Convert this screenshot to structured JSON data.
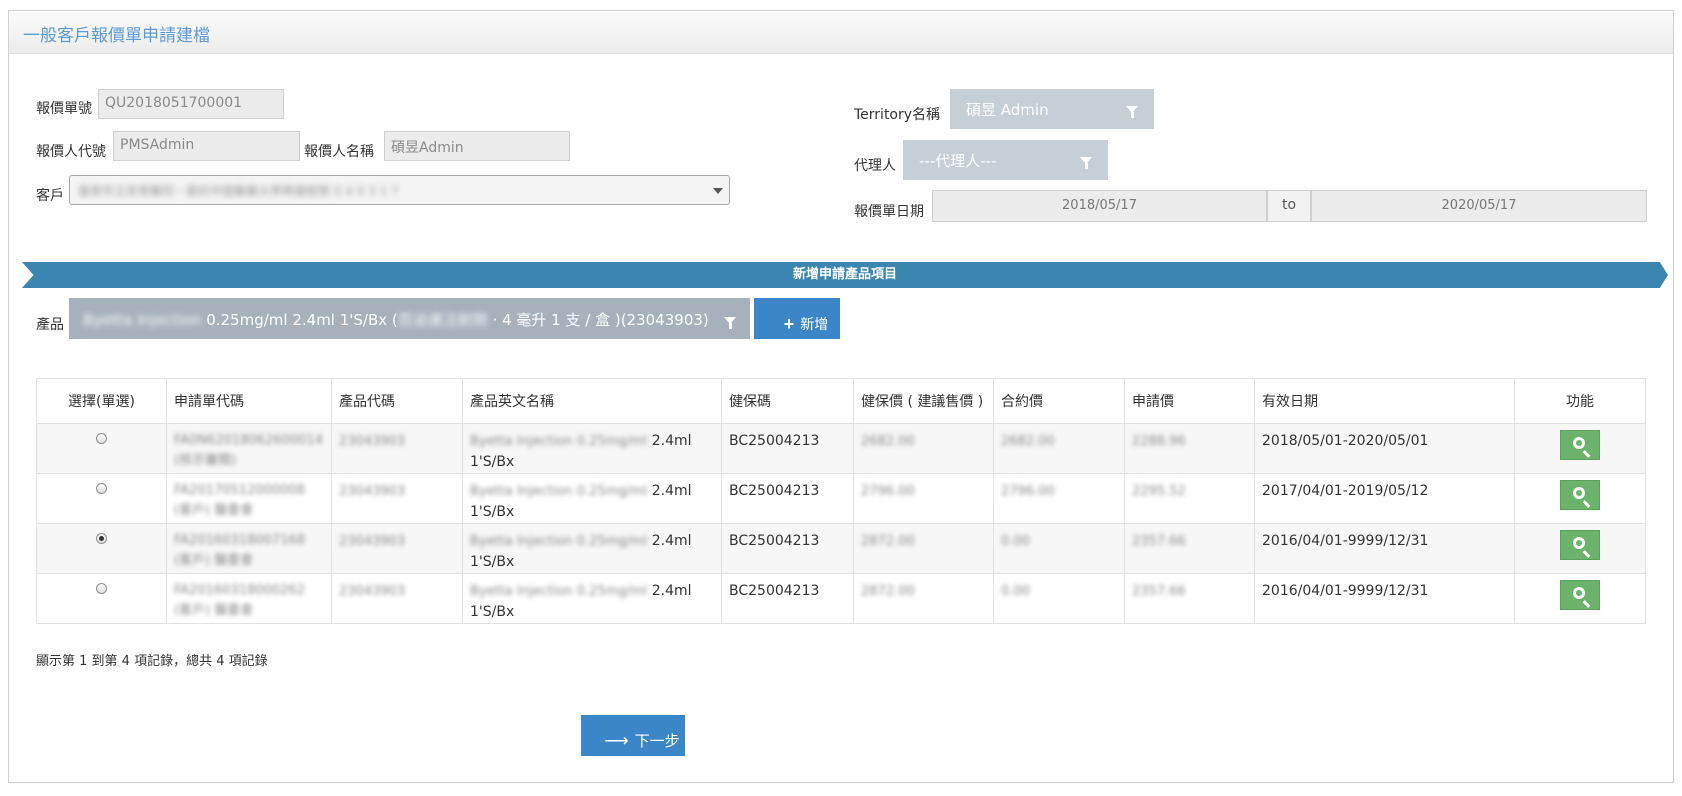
{
  "page": {
    "title": "一般客戶報價單申請建檔"
  },
  "form": {
    "quote_no_label": "報價單號",
    "quote_no_value": "QU2018051700001",
    "quoter_code_label": "報價人代號",
    "quoter_code_value": "PMSAdmin",
    "quoter_name_label": "報價人名稱",
    "quoter_name_value": "碩昱Admin",
    "customer_label": "客戶",
    "customer_value": "臺南市立安南醫院－委託中國醫藥大學興建經營 0 4 0 3 1 7",
    "territory_label": "Territory名稱",
    "territory_value": "碩昱 Admin",
    "agent_label": "代理人",
    "agent_value": "---代理人---",
    "quote_date_label": "報價單日期",
    "date_from": "2018/05/17",
    "date_to_label": "to",
    "date_to": "2020/05/17"
  },
  "banner": {
    "title": "新增申請產品項目"
  },
  "product": {
    "label": "產品",
    "selected_blur_prefix": "Byetta Injection",
    "selected_main": " 0.25mg/ml 2.4ml 1'S/Bx (",
    "selected_blur_mid": "百泌達注射劑",
    "selected_suffix": " · 4 毫升 1 支 / 盒 )(23043903)",
    "add_button": "新增"
  },
  "table": {
    "headers": [
      "選擇(單選)",
      "申請單代碼",
      "產品代碼",
      "產品英文名稱",
      "健保碼",
      "健保價 ( 建議售價 )",
      "合約價",
      "申請價",
      "有效日期",
      "功能"
    ],
    "rows": [
      {
        "selected": false,
        "app_code": "FA0N62018062600014",
        "app_code_sub": "(核示審閱)",
        "product_code": "23043903",
        "name_blur": "Byetta Injection 0.25mg/ml",
        "name_tail": " 2.4ml",
        "name_line2": "1'S/Bx",
        "nhi_code": "BC25004213",
        "nhi_price": "2682.00",
        "contract_price": "2682.00",
        "apply_price": "2288.96",
        "valid_dates": "2018/05/01-2020/05/01"
      },
      {
        "selected": false,
        "app_code": "FA20170512000008",
        "app_code_sub": "(客戶) 醫委會",
        "product_code": "23043903",
        "name_blur": "Byetta Injection 0.25mg/ml",
        "name_tail": " 2.4ml",
        "name_line2": "1'S/Bx",
        "nhi_code": "BC25004213",
        "nhi_price": "2796.00",
        "contract_price": "2796.00",
        "apply_price": "2295.52",
        "valid_dates": "2017/04/01-2019/05/12"
      },
      {
        "selected": true,
        "app_code": "FA20160318007168",
        "app_code_sub": "(客戶) 醫委會",
        "product_code": "23043903",
        "name_blur": "Byetta Injection 0.25mg/ml",
        "name_tail": " 2.4ml",
        "name_line2": "1'S/Bx",
        "nhi_code": "BC25004213",
        "nhi_price": "2872.00",
        "contract_price": "0.00",
        "apply_price": "2357.66",
        "valid_dates": "2016/04/01-9999/12/31"
      },
      {
        "selected": false,
        "app_code": "FA20160318000262",
        "app_code_sub": "(客戶) 醫委會",
        "product_code": "23043903",
        "name_blur": "Byetta Injection 0.25mg/ml",
        "name_tail": " 2.4ml",
        "name_line2": "1'S/Bx",
        "nhi_code": "BC25004213",
        "nhi_price": "2872.00",
        "contract_price": "0.00",
        "apply_price": "2357.66",
        "valid_dates": "2016/04/01-9999/12/31"
      }
    ]
  },
  "footer": {
    "record_info": "顯示第 1 到第 4 項記錄，總共 4 項記錄",
    "next_button": "下一步"
  },
  "colors": {
    "title": "#5b9bd5",
    "banner": "#3a86b0",
    "primary_button": "#3a86c8",
    "view_button": "#6bb36b",
    "dropdown": "#c6ced6"
  },
  "icons": {
    "add": "plus-icon",
    "view": "search-icon",
    "next": "arrow-right-icon",
    "dropdown": "filter-caret-icon"
  }
}
